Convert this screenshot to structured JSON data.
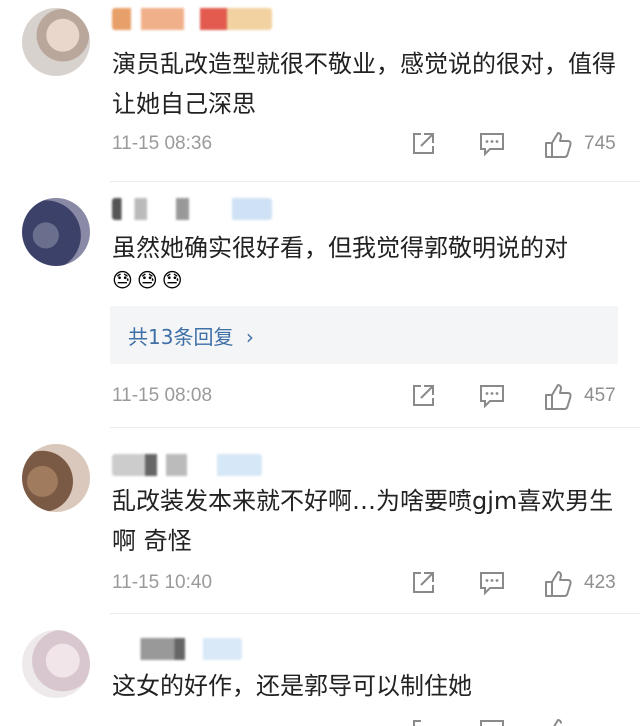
{
  "comments": [
    {
      "text": "演员乱改造型就很不敬业，感觉说的很对，值得让她自己深思",
      "emojis": "",
      "replies": "",
      "time": "11-15 08:36",
      "likes": "745"
    },
    {
      "text": "虽然她确实很好看，但我觉得郭敬明说的对",
      "emojis": "😓😓😓",
      "replies": "共13条回复",
      "time": "11-15 08:08",
      "likes": "457"
    },
    {
      "text": "乱改装发本来就不好啊…为啥要喷gjm喜欢男生啊 奇怪",
      "emojis": "",
      "replies": "",
      "time": "11-15 10:40",
      "likes": "423"
    },
    {
      "text": "这女的好作，还是郭导可以制住她",
      "emojis": "",
      "replies": "",
      "time": "",
      "likes": ""
    }
  ],
  "icons": {
    "share": "share-icon",
    "reply": "comment-icon",
    "like": "thumbs-up-icon",
    "chevron": "chevron-right-icon"
  },
  "colors": {
    "link": "#3e6fa6",
    "meta": "#9a9a9a",
    "text": "#222222"
  }
}
